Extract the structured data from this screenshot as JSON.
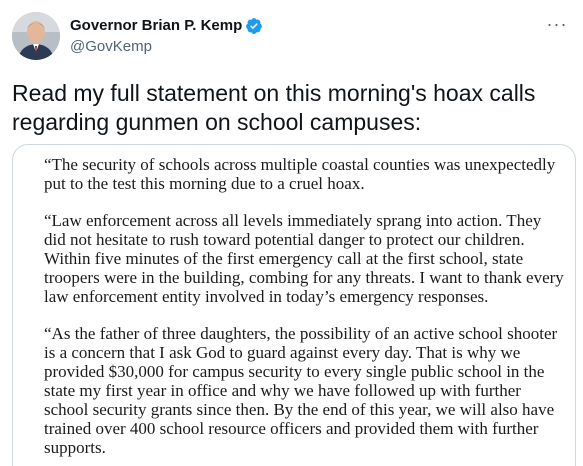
{
  "author": {
    "display_name": "Governor Brian P. Kemp",
    "handle": "@GovKemp",
    "verified_icon": "verified-badge-icon",
    "avatar_icon": "profile-photo"
  },
  "more_label": "···",
  "tweet_text": "Read my full statement on this morning's hoax calls regarding gunmen on school campuses:",
  "statement": {
    "paragraphs": [
      "“The security of schools across multiple coastal counties was unexpectedly put to the test this morning due to a cruel hoax.",
      "“Law enforcement across all levels immediately sprang into action. They did not hesitate to rush toward potential danger to protect our children. Within five minutes of the first emergency call at the first school, state troopers were in the building, combing for any threats. I want to thank every law enforcement entity involved in today’s emergency responses.",
      "“As the father of three daughters, the possibility of an active school shooter is a concern that I ask God to guard against every day. That is why we provided $30,000 for campus security to every single public school in the state my first year in office and why we have followed up with further school security grants since then. By the end of this year, we will also have trained over 400 school resource officers and provided them with further supports."
    ]
  },
  "colors": {
    "verified": "#1d9bf0",
    "secondary_text": "#536471",
    "card_border": "#cfd9de"
  }
}
